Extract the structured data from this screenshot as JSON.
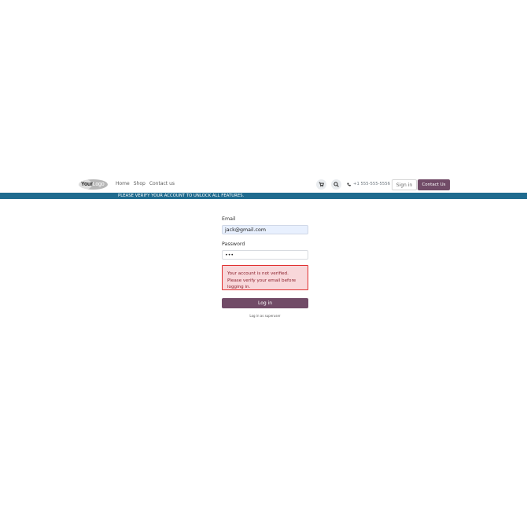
{
  "header": {
    "logo": {
      "part1": "Your",
      "part2": "Logo"
    },
    "nav": [
      "Home",
      "Shop",
      "Contact us"
    ],
    "cart_icon": "cart-icon",
    "search_icon": "search-icon",
    "phone_icon": "phone-icon",
    "phone": "+1 555-555-5556",
    "signin_label": "Sign in",
    "contact_label": "Contact Us"
  },
  "banner": {
    "text": "PLEASE VERIFY YOUR ACCOUNT TO UNLOCK ALL FEATURES."
  },
  "login": {
    "email_label": "Email",
    "email_value": "jack@gmail.com",
    "password_label": "Password",
    "password_value": "•••",
    "error": "Your account is not verified. Please verify your email before logging in.",
    "login_button": "Log in",
    "superuser_link": "Log in as superuser"
  },
  "colors": {
    "brand": "#714b67",
    "banner": "#1f6b8f",
    "alert_bg": "#f8d7da",
    "alert_border": "#e03131"
  }
}
